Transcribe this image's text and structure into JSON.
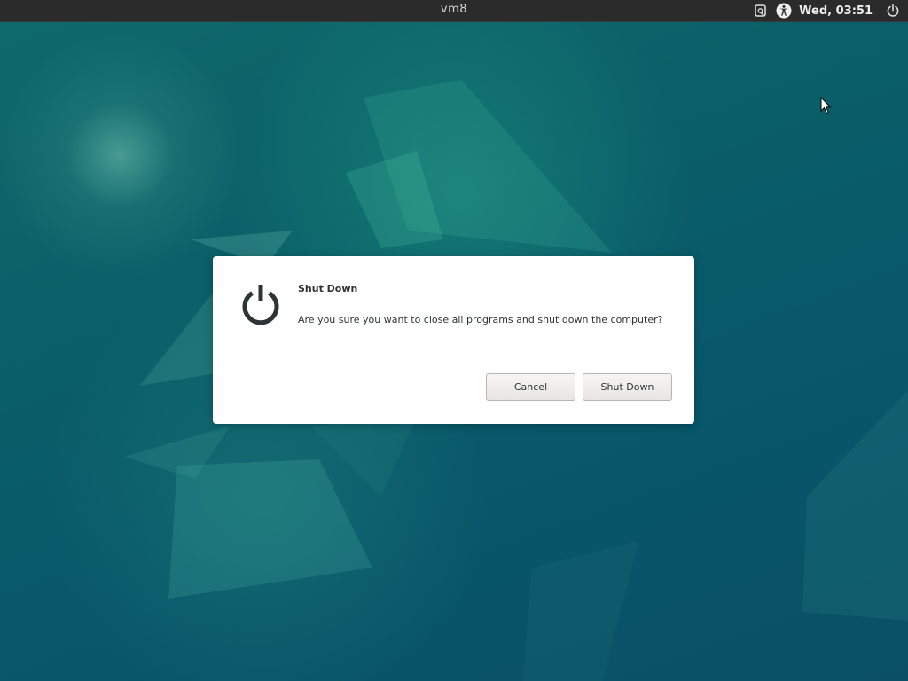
{
  "topbar": {
    "title": "vm8",
    "clock": "Wed, 03:51",
    "icons": [
      "sync-icon",
      "accessibility-icon",
      "power-icon"
    ]
  },
  "dialog": {
    "icon": "power-icon",
    "title": "Shut Down",
    "message": "Are you sure you want to close all programs and shut down the computer?",
    "cancel_label": "Cancel",
    "confirm_label": "Shut Down"
  },
  "colors": {
    "topbar_bg": "#2b2b2b",
    "wallpaper_base": "#0a5f68",
    "dialog_bg": "#ffffff"
  }
}
